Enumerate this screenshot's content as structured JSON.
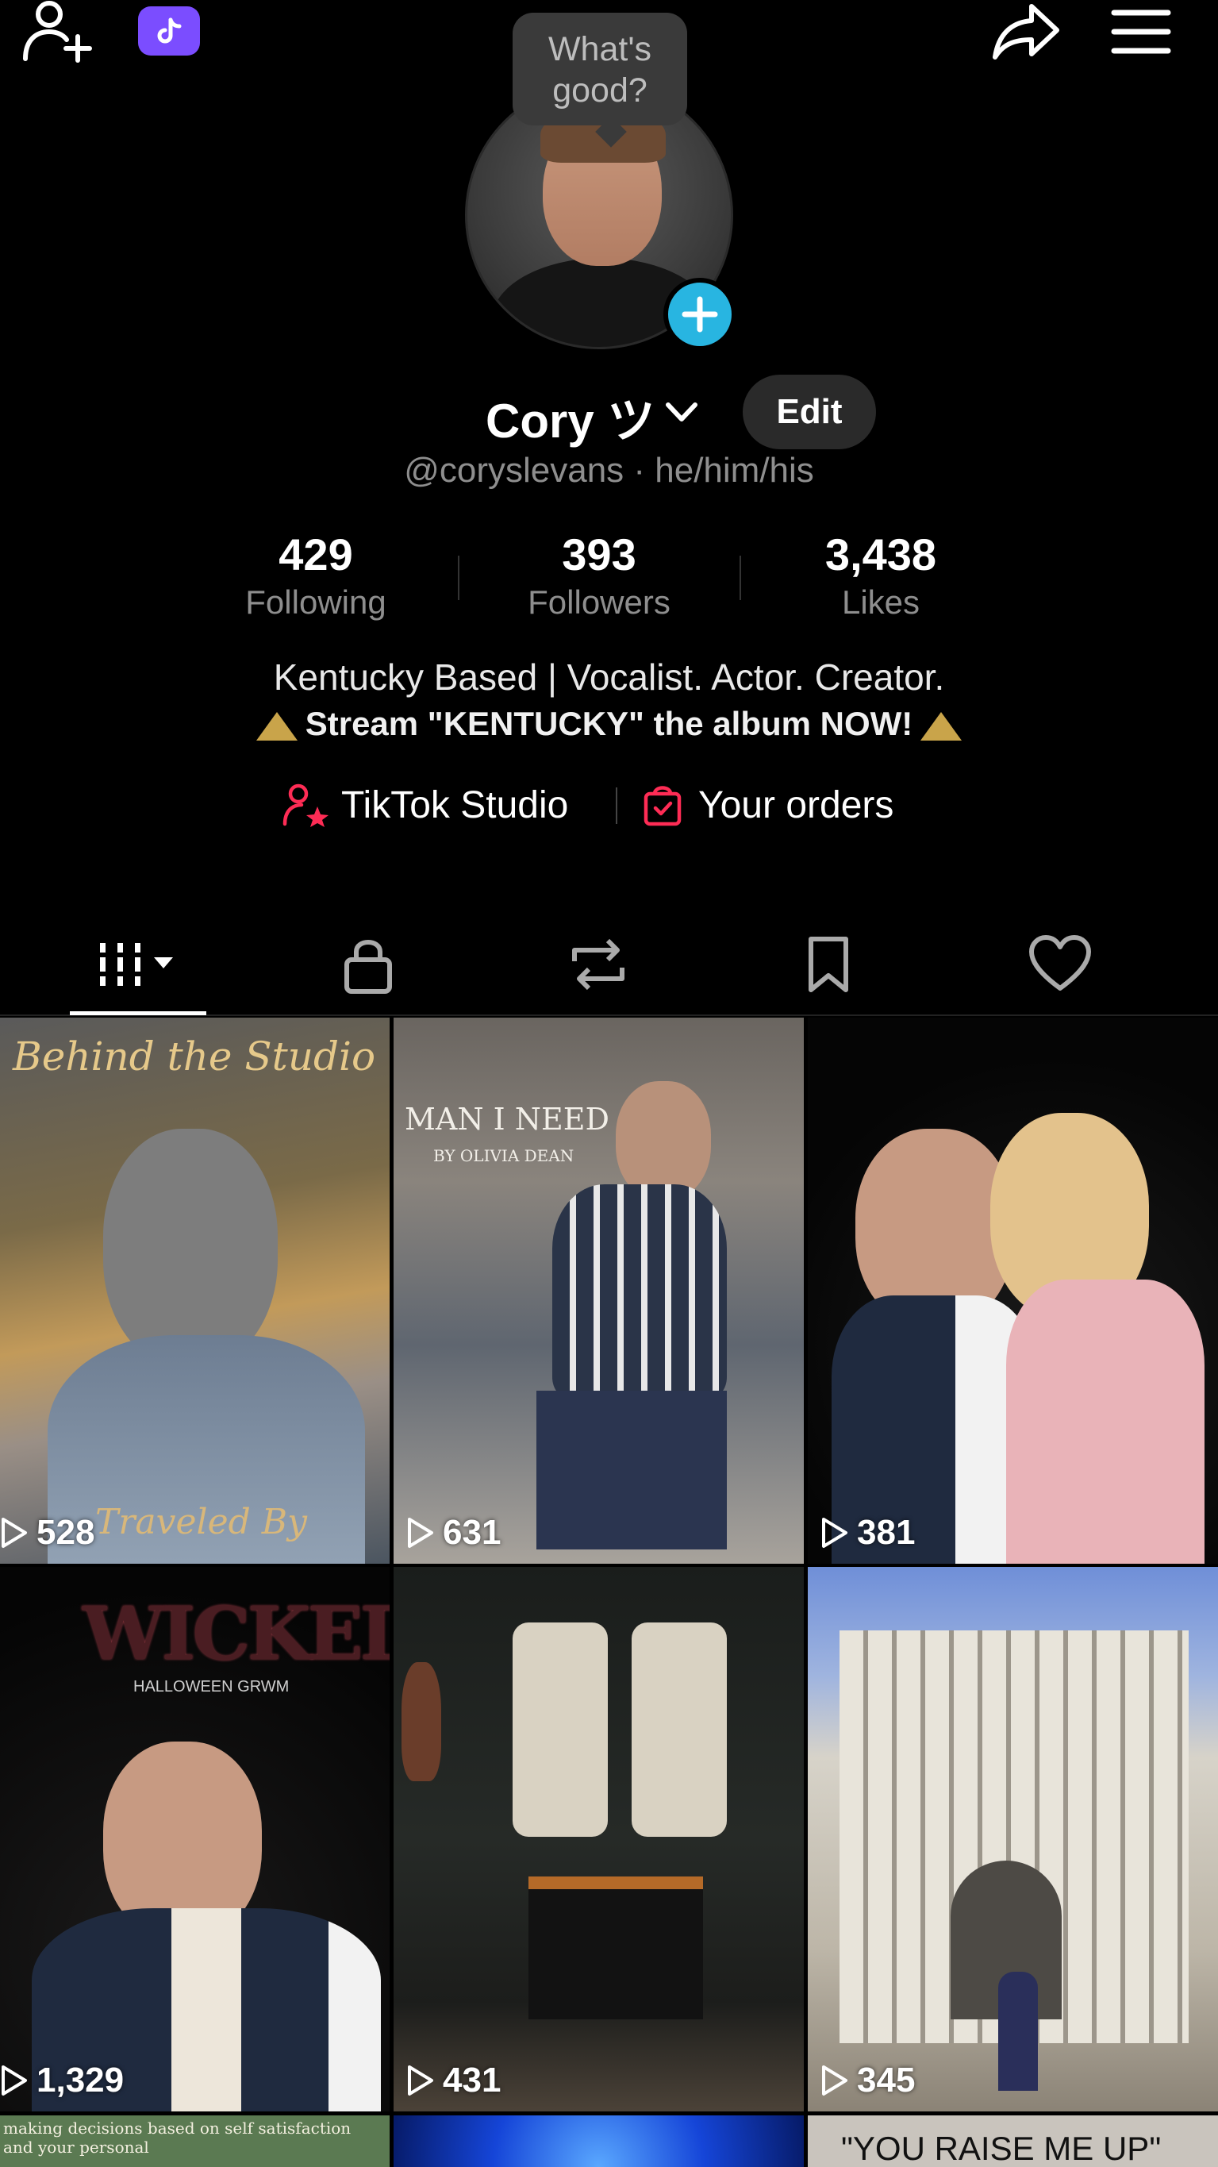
{
  "topbar": {
    "add_friend_icon": "add-friend-icon",
    "badge_icon": "tiktok-logo-icon",
    "share_icon": "share-icon",
    "menu_icon": "menu-icon"
  },
  "profile": {
    "bubble": "What's good?",
    "name": "Cory ツ",
    "edit_label": "Edit",
    "handle": "@coryslevans · he/him/his",
    "stats": [
      {
        "value": "429",
        "label": "Following"
      },
      {
        "value": "393",
        "label": "Followers"
      },
      {
        "value": "3,438",
        "label": "Likes"
      }
    ],
    "bio_line1": "Kentucky Based | Vocalist. Actor. Creator.",
    "bio_line2": "Stream \"KENTUCKY\" the album NOW!",
    "links": [
      {
        "label": "TikTok Studio",
        "icon": "creator-star-icon"
      },
      {
        "label": "Your orders",
        "icon": "shopping-bag-icon"
      }
    ]
  },
  "tabs": [
    {
      "name": "videos",
      "icon": "grid-videos-icon",
      "active": true
    },
    {
      "name": "private",
      "icon": "lock-icon"
    },
    {
      "name": "reposts",
      "icon": "repost-icon"
    },
    {
      "name": "favorites",
      "icon": "bookmark-icon"
    },
    {
      "name": "liked",
      "icon": "heart-icon"
    }
  ],
  "videos": [
    {
      "views": "528",
      "overlay": "Behind the Studio",
      "caption": "Traveled By"
    },
    {
      "views": "631",
      "overlay": "MAN I NEED",
      "sub": "BY OLIVIA DEAN"
    },
    {
      "views": "381"
    },
    {
      "views": "1,329",
      "overlay": "WICKED",
      "sub": "HALLOWEEN GRWM"
    },
    {
      "views": "431"
    },
    {
      "views": "345"
    }
  ],
  "partial_row": {
    "left_text": "making decisions based on self satisfaction and your personal",
    "right_text": "\"YOU RAISE ME UP\""
  },
  "colors": {
    "accent_blue": "#28b5e1",
    "badge_purple": "#7b4dff",
    "link_red": "#fe2c55"
  }
}
